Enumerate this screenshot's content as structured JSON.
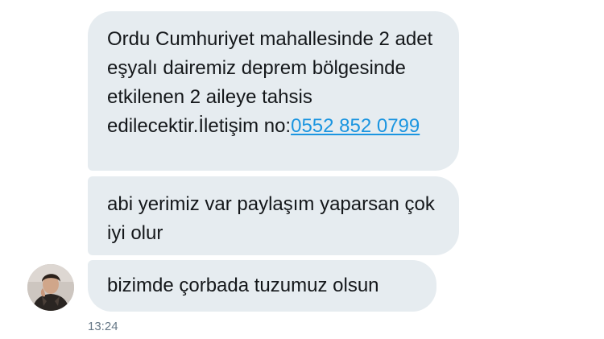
{
  "messages": [
    {
      "text_before_link": "Ordu Cumhuriyet mahallesinde 2 adet eşyalı dairemiz deprem bölgesinde etkilenen 2 aileye tahsis edilecektir.İletişim no:",
      "link_text": "0552 852 0799"
    },
    {
      "text": "abi yerimiz var paylaşım yaparsan çok iyi olur"
    },
    {
      "text": "bizimde çorbada tuzumuz olsun"
    }
  ],
  "timestamp": "13:24",
  "colors": {
    "bubble_background": "#e6ecf0",
    "message_text": "#14171a",
    "link": "#1b95e0",
    "timestamp_text": "#657786"
  }
}
